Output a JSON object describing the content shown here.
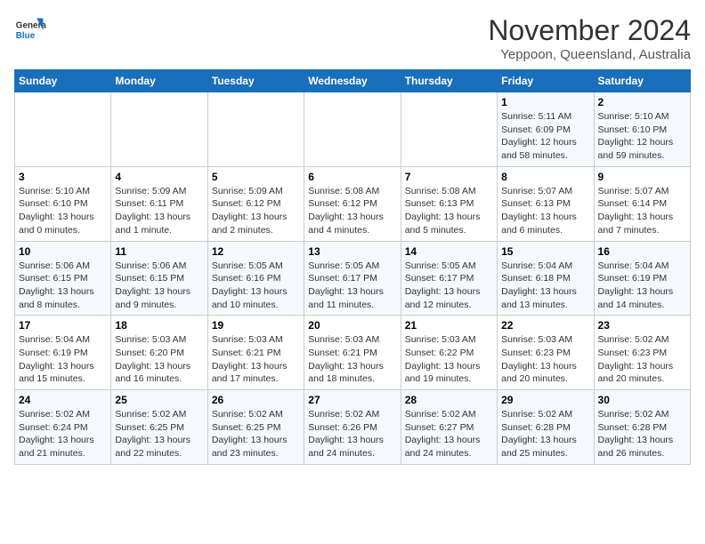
{
  "header": {
    "logo_line1": "General",
    "logo_line2": "Blue",
    "month_title": "November 2024",
    "subtitle": "Yeppoon, Queensland, Australia"
  },
  "weekdays": [
    "Sunday",
    "Monday",
    "Tuesday",
    "Wednesday",
    "Thursday",
    "Friday",
    "Saturday"
  ],
  "weeks": [
    [
      {
        "day": "",
        "info": ""
      },
      {
        "day": "",
        "info": ""
      },
      {
        "day": "",
        "info": ""
      },
      {
        "day": "",
        "info": ""
      },
      {
        "day": "",
        "info": ""
      },
      {
        "day": "1",
        "info": "Sunrise: 5:11 AM\nSunset: 6:09 PM\nDaylight: 12 hours and 58 minutes."
      },
      {
        "day": "2",
        "info": "Sunrise: 5:10 AM\nSunset: 6:10 PM\nDaylight: 12 hours and 59 minutes."
      }
    ],
    [
      {
        "day": "3",
        "info": "Sunrise: 5:10 AM\nSunset: 6:10 PM\nDaylight: 13 hours and 0 minutes."
      },
      {
        "day": "4",
        "info": "Sunrise: 5:09 AM\nSunset: 6:11 PM\nDaylight: 13 hours and 1 minute."
      },
      {
        "day": "5",
        "info": "Sunrise: 5:09 AM\nSunset: 6:12 PM\nDaylight: 13 hours and 2 minutes."
      },
      {
        "day": "6",
        "info": "Sunrise: 5:08 AM\nSunset: 6:12 PM\nDaylight: 13 hours and 4 minutes."
      },
      {
        "day": "7",
        "info": "Sunrise: 5:08 AM\nSunset: 6:13 PM\nDaylight: 13 hours and 5 minutes."
      },
      {
        "day": "8",
        "info": "Sunrise: 5:07 AM\nSunset: 6:13 PM\nDaylight: 13 hours and 6 minutes."
      },
      {
        "day": "9",
        "info": "Sunrise: 5:07 AM\nSunset: 6:14 PM\nDaylight: 13 hours and 7 minutes."
      }
    ],
    [
      {
        "day": "10",
        "info": "Sunrise: 5:06 AM\nSunset: 6:15 PM\nDaylight: 13 hours and 8 minutes."
      },
      {
        "day": "11",
        "info": "Sunrise: 5:06 AM\nSunset: 6:15 PM\nDaylight: 13 hours and 9 minutes."
      },
      {
        "day": "12",
        "info": "Sunrise: 5:05 AM\nSunset: 6:16 PM\nDaylight: 13 hours and 10 minutes."
      },
      {
        "day": "13",
        "info": "Sunrise: 5:05 AM\nSunset: 6:17 PM\nDaylight: 13 hours and 11 minutes."
      },
      {
        "day": "14",
        "info": "Sunrise: 5:05 AM\nSunset: 6:17 PM\nDaylight: 13 hours and 12 minutes."
      },
      {
        "day": "15",
        "info": "Sunrise: 5:04 AM\nSunset: 6:18 PM\nDaylight: 13 hours and 13 minutes."
      },
      {
        "day": "16",
        "info": "Sunrise: 5:04 AM\nSunset: 6:19 PM\nDaylight: 13 hours and 14 minutes."
      }
    ],
    [
      {
        "day": "17",
        "info": "Sunrise: 5:04 AM\nSunset: 6:19 PM\nDaylight: 13 hours and 15 minutes."
      },
      {
        "day": "18",
        "info": "Sunrise: 5:03 AM\nSunset: 6:20 PM\nDaylight: 13 hours and 16 minutes."
      },
      {
        "day": "19",
        "info": "Sunrise: 5:03 AM\nSunset: 6:21 PM\nDaylight: 13 hours and 17 minutes."
      },
      {
        "day": "20",
        "info": "Sunrise: 5:03 AM\nSunset: 6:21 PM\nDaylight: 13 hours and 18 minutes."
      },
      {
        "day": "21",
        "info": "Sunrise: 5:03 AM\nSunset: 6:22 PM\nDaylight: 13 hours and 19 minutes."
      },
      {
        "day": "22",
        "info": "Sunrise: 5:03 AM\nSunset: 6:23 PM\nDaylight: 13 hours and 20 minutes."
      },
      {
        "day": "23",
        "info": "Sunrise: 5:02 AM\nSunset: 6:23 PM\nDaylight: 13 hours and 20 minutes."
      }
    ],
    [
      {
        "day": "24",
        "info": "Sunrise: 5:02 AM\nSunset: 6:24 PM\nDaylight: 13 hours and 21 minutes."
      },
      {
        "day": "25",
        "info": "Sunrise: 5:02 AM\nSunset: 6:25 PM\nDaylight: 13 hours and 22 minutes."
      },
      {
        "day": "26",
        "info": "Sunrise: 5:02 AM\nSunset: 6:25 PM\nDaylight: 13 hours and 23 minutes."
      },
      {
        "day": "27",
        "info": "Sunrise: 5:02 AM\nSunset: 6:26 PM\nDaylight: 13 hours and 24 minutes."
      },
      {
        "day": "28",
        "info": "Sunrise: 5:02 AM\nSunset: 6:27 PM\nDaylight: 13 hours and 24 minutes."
      },
      {
        "day": "29",
        "info": "Sunrise: 5:02 AM\nSunset: 6:28 PM\nDaylight: 13 hours and 25 minutes."
      },
      {
        "day": "30",
        "info": "Sunrise: 5:02 AM\nSunset: 6:28 PM\nDaylight: 13 hours and 26 minutes."
      }
    ]
  ]
}
